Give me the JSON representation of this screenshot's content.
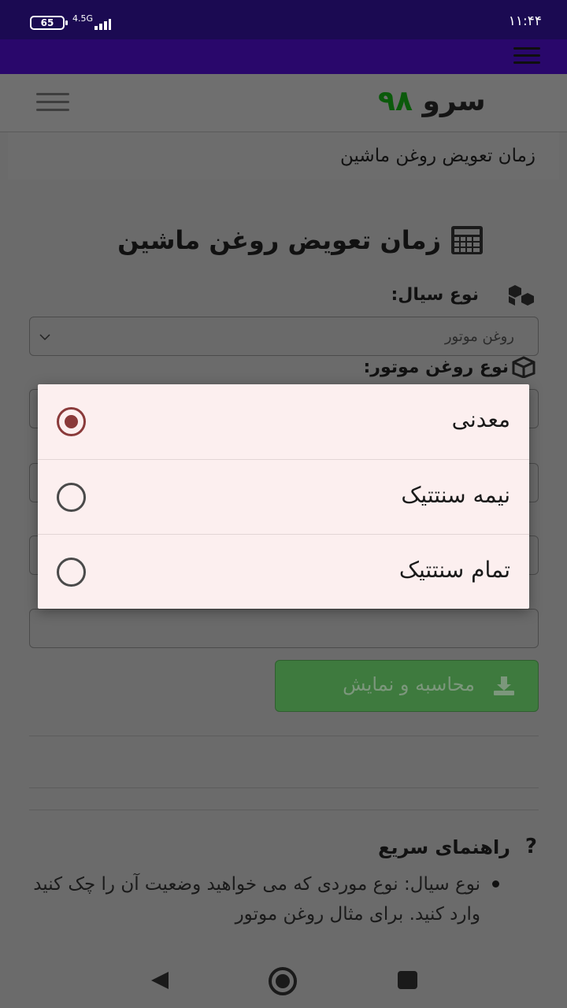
{
  "status_bar": {
    "battery": "65",
    "network": "4.5G",
    "time": "۱۱:۴۴"
  },
  "header": {
    "logo_word": "سرو",
    "logo_number": "۹۸"
  },
  "breadcrumb": "زمان تعویض روغن ماشین",
  "page_title": "زمان تعویض روغن ماشین",
  "form": {
    "fluid_type_label": "نوع سیال:",
    "fluid_type_value": "روغن موتور",
    "oil_type_label": "نوع روغن موتور:",
    "submit_label": "محاسبه و نمایش"
  },
  "guide": {
    "title": "راهنمای سریع",
    "question_mark": "?",
    "bullet_text": "نوع سیال: نوع موردی که می خواهید وضعیت آن را چک کنید وارد کنید. برای مثال روغن موتور"
  },
  "dialog": {
    "options": [
      {
        "label": "معدنی",
        "selected": true
      },
      {
        "label": "نیمه سنتتیک",
        "selected": false
      },
      {
        "label": "تمام سنتتیک",
        "selected": false
      }
    ]
  },
  "colors": {
    "status_bar": "#1b0a52",
    "app_bar": "#29076b",
    "logo_number": "#0b5a0b",
    "radio_selected": "#8a3a3a",
    "dialog_bg": "#fcefef"
  },
  "icons": {
    "calculator": "calculator-icon",
    "cubes": "cubes-icon",
    "cube": "cube-icon",
    "download": "download-icon"
  }
}
